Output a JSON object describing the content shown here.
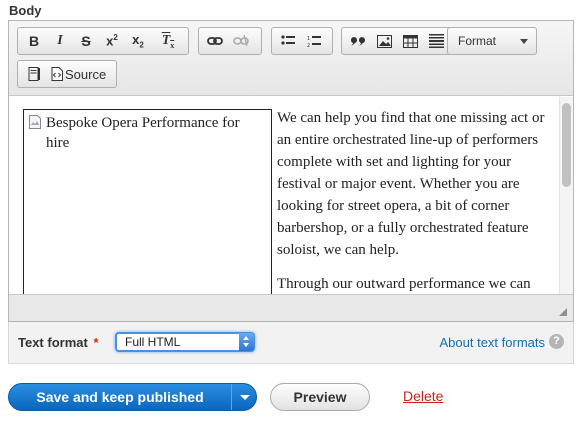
{
  "body_label": "Body",
  "toolbar": {
    "bold_label": "B",
    "italic_label": "I",
    "strike_label": "S",
    "superscript_label": "x",
    "superscript_mark": "2",
    "subscript_label": "x",
    "subscript_mark": "2",
    "remove_format_label": "T",
    "remove_format_mark": "x",
    "format_label": "Format",
    "source_label": "Source"
  },
  "content": {
    "image_alt": "Bespoke Opera Performance for hire",
    "paragraph_1": "We can help you find that one missing act or an entire orchestrated line-up of performers complete with set and lighting for your festival or major event. Whether you are looking for street opera, a bit of corner barbershop, or a fully orchestrated feature soloist, we can help.",
    "paragraph_2": "Through our outward performance we can draw attention to your company, make the"
  },
  "text_format": {
    "label": "Text format",
    "required_mark": "*",
    "selected": "Full HTML",
    "about_link": "About text formats",
    "help_glyph": "?"
  },
  "actions": {
    "save_label": "Save and keep published",
    "preview_label": "Preview",
    "delete_label": "Delete"
  },
  "colors": {
    "primary": "#0a67be",
    "link": "#0f6fb5",
    "danger": "#c5221f"
  },
  "icons": [
    "bold-icon",
    "italic-icon",
    "strikethrough-icon",
    "superscript-icon",
    "subscript-icon",
    "remove-format-icon",
    "link-icon",
    "unlink-icon",
    "bulleted-list-icon",
    "numbered-list-icon",
    "blockquote-icon",
    "image-icon",
    "table-icon",
    "horizontal-line-icon",
    "maximize-icon",
    "source-icon",
    "broken-image-icon",
    "resize-icon",
    "help-icon",
    "chevron-down-icon"
  ]
}
